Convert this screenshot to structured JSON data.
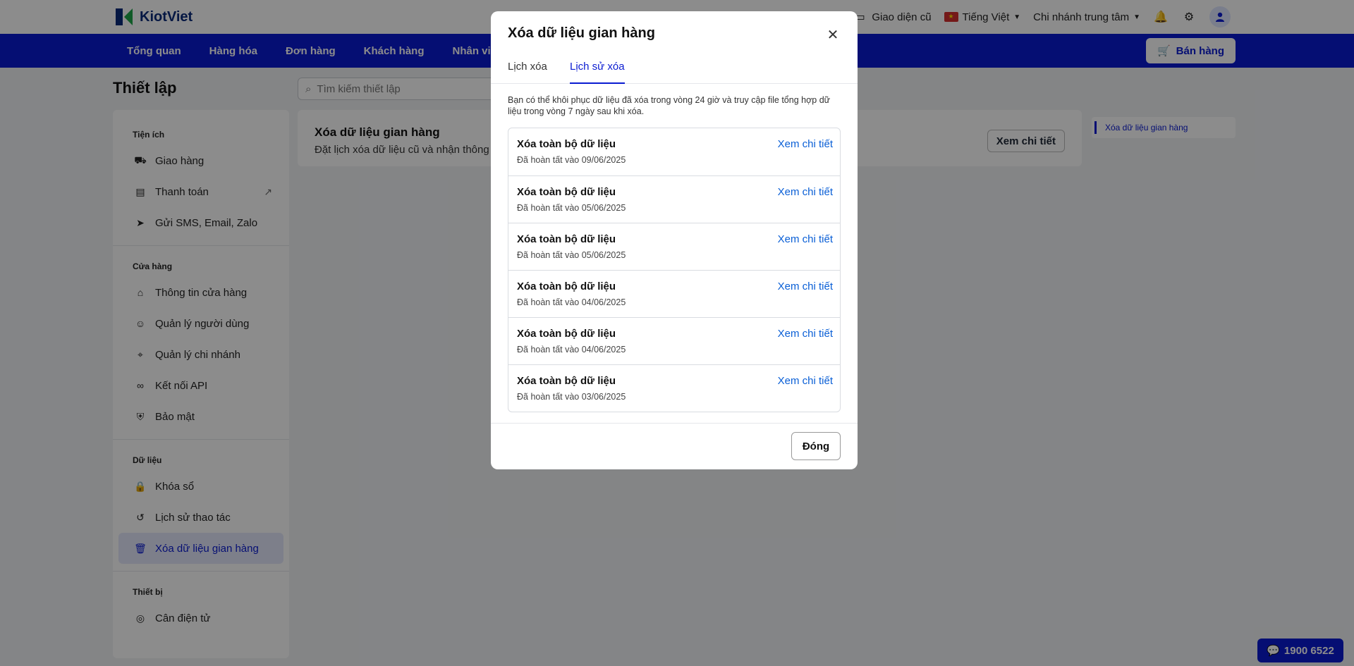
{
  "header": {
    "brand": "KiotViet",
    "old_ui": "Giao diện cũ",
    "language": "Tiếng Việt",
    "branch": "Chi nhánh trung tâm"
  },
  "nav": {
    "items": [
      "Tổng quan",
      "Hàng hóa",
      "Đơn hàng",
      "Khách hàng",
      "Nhân viên"
    ],
    "sell_button": "Bán hàng"
  },
  "page": {
    "title": "Thiết lập",
    "search_placeholder": "Tìm kiếm thiết lập"
  },
  "sidebar": {
    "sections": [
      {
        "heading": "Tiện ích",
        "items": [
          "Giao hàng",
          "Thanh toán",
          "Gửi SMS, Email, Zalo"
        ]
      },
      {
        "heading": "Cửa hàng",
        "items": [
          "Thông tin cửa hàng",
          "Quản lý người dùng",
          "Quản lý chi nhánh",
          "Kết nối API",
          "Bảo mật"
        ]
      },
      {
        "heading": "Dữ liệu",
        "items": [
          "Khóa sổ",
          "Lịch sử thao tác",
          "Xóa dữ liệu gian hàng"
        ]
      },
      {
        "heading": "Thiết bị",
        "items": [
          "Cân điện tử"
        ]
      }
    ]
  },
  "content": {
    "title": "Xóa dữ liệu gian hàng",
    "desc": "Đặt lịch xóa dữ liệu cũ và nhận thông b",
    "button": "Xem chi tiết",
    "toc_item": "Xóa dữ liệu gian hàng"
  },
  "hotline": "1900 6522",
  "modal": {
    "title": "Xóa dữ liệu gian hàng",
    "tabs": [
      "Lịch xóa",
      "Lịch sử xóa"
    ],
    "info": "Bạn có thể khôi phục dữ liệu đã xóa trong vòng 24 giờ và truy cập file tổng hợp dữ liệu trong vòng 7 ngày sau khi xóa.",
    "rows": [
      {
        "title": "Xóa toàn bộ dữ liệu",
        "sub": "Đã hoàn tất vào 09/06/2025",
        "link": "Xem chi tiết"
      },
      {
        "title": "Xóa toàn bộ dữ liệu",
        "sub": "Đã hoàn tất vào 05/06/2025",
        "link": "Xem chi tiết"
      },
      {
        "title": "Xóa toàn bộ dữ liệu",
        "sub": "Đã hoàn tất vào 05/06/2025",
        "link": "Xem chi tiết"
      },
      {
        "title": "Xóa toàn bộ dữ liệu",
        "sub": "Đã hoàn tất vào 04/06/2025",
        "link": "Xem chi tiết"
      },
      {
        "title": "Xóa toàn bộ dữ liệu",
        "sub": "Đã hoàn tất vào 04/06/2025",
        "link": "Xem chi tiết"
      },
      {
        "title": "Xóa toàn bộ dữ liệu",
        "sub": "Đã hoàn tất vào 03/06/2025",
        "link": "Xem chi tiết"
      }
    ],
    "close_button": "Đóng"
  }
}
